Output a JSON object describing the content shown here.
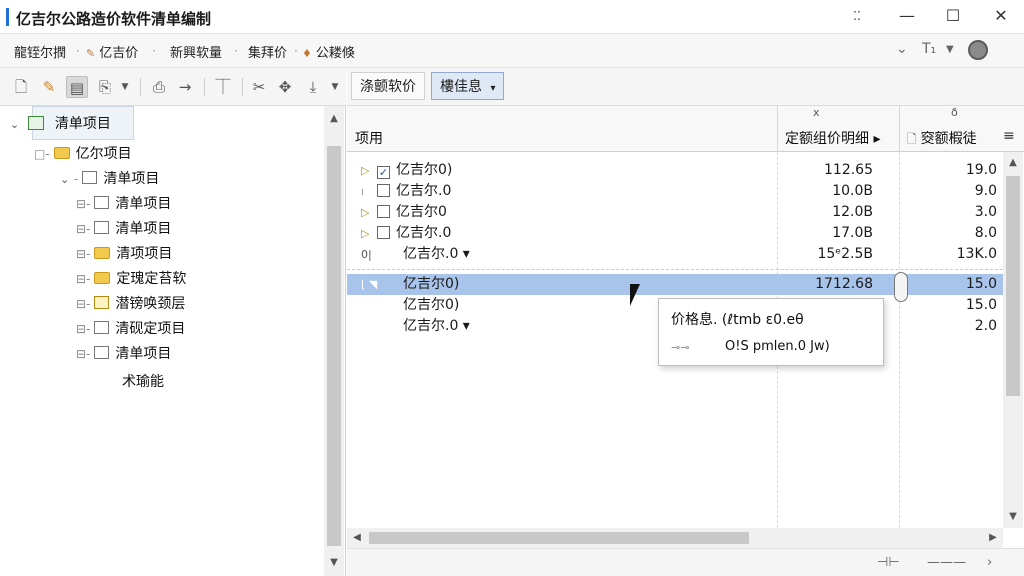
{
  "window": {
    "title": "亿吉尔公路造价软件清单编制",
    "controls": {
      "settings": "⁚⁚",
      "minimize": "—",
      "maximize": "☐",
      "close": "✕"
    }
  },
  "menubar": {
    "items": [
      "龍铚尔撋",
      "亿吉价",
      "新興软量",
      "集拜价",
      "公耧倏"
    ],
    "right_icons": [
      "chevron-down-icon",
      "text-format-icon",
      "dropdown-icon",
      "globe-icon"
    ]
  },
  "left_toolbar": {
    "icons": [
      "new-document-icon",
      "edit-pen-icon",
      "grid-view-icon",
      "copy-icon",
      "dropdown-arrow-icon",
      "export-icon",
      "arrow-right-icon",
      "align-icon",
      "cut-icon",
      "move-icon",
      "move-down-icon",
      "dropdown-arrow-icon"
    ]
  },
  "tree": {
    "root": "清单项目",
    "items": [
      {
        "label": "亿尔项目",
        "level": 1,
        "icon": "folder"
      },
      {
        "label": "清单项目",
        "level": 2,
        "icon": "doc"
      },
      {
        "label": "清单项目",
        "level": 3,
        "icon": "doc"
      },
      {
        "label": "清单项目",
        "level": 3,
        "icon": "doc"
      },
      {
        "label": "清项项目",
        "level": 3,
        "icon": "folder"
      },
      {
        "label": "定瑰定苔软",
        "level": 3,
        "icon": "folder"
      },
      {
        "label": "潜镑唤颈层",
        "level": 3,
        "icon": "chart"
      },
      {
        "label": "清砚定项目",
        "level": 3,
        "icon": "doc"
      },
      {
        "label": "清单项目",
        "level": 3,
        "icon": "doc"
      },
      {
        "label": "术瑜能",
        "level": 4,
        "icon": "none"
      }
    ]
  },
  "right_toolbar": {
    "tab1": "涤颤软价",
    "tab2": "樓佳息",
    "tab2_arrow": "▾"
  },
  "grid": {
    "header": {
      "top_x": "x",
      "top_right": "ð",
      "col_item": "项用",
      "col_price": "定额组价明细 ▸",
      "col_qty": "窔额椵徒",
      "menu_icon": "≡"
    },
    "rows": [
      {
        "expander": "▷",
        "check": true,
        "name": "亿吉尔0)",
        "price": "112.65",
        "qty": "19.0"
      },
      {
        "expander": "",
        "check": false,
        "name": "亿吉尔.0",
        "price": "10.0B",
        "qty": "9.0"
      },
      {
        "expander": "▷",
        "check": false,
        "name": "亿吉尔0",
        "price": "12.0B",
        "qty": "3.0"
      },
      {
        "expander": "▷",
        "check": false,
        "name": "亿吉尔.0",
        "price": "17.0B",
        "qty": "8.0"
      },
      {
        "expander": "0|",
        "check": null,
        "name": "亿吉尔.0 ▾",
        "price": "15ᵉ2.5B",
        "qty": "13K.0"
      },
      {
        "expander": "",
        "check": null,
        "name": "亿吉尔0)",
        "price": "1712.68",
        "qty": "15.0",
        "selected": true
      },
      {
        "expander": "",
        "check": null,
        "name": "亿吉尔0)",
        "price": "5",
        "qty": "15.0"
      },
      {
        "expander": "",
        "check": null,
        "name": "亿吉尔.0 ▾",
        "price": "5",
        "qty": "2.0"
      }
    ]
  },
  "tooltip": {
    "line1": "价格息. (ℓtmb ε0.eθ",
    "line2": "O!S pmlen.0 Jw)",
    "icon": "⊸⊸"
  },
  "status": {
    "icons": [
      "zoom-fit-icon",
      "zoom-slider-icon",
      "chevron-right-icon"
    ]
  },
  "colors": {
    "accent": "#1e6fd9",
    "selection": "#a9c4ea",
    "tab_active": "#dfe8f5"
  }
}
